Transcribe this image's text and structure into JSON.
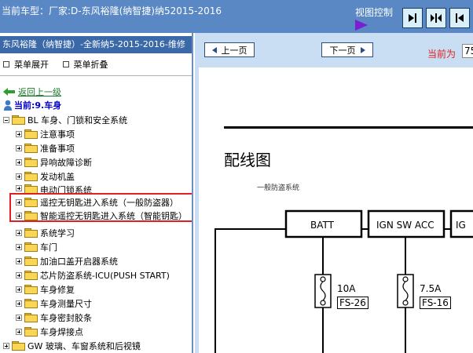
{
  "header": {
    "title": "当前车型：厂家:D-东风裕隆(纳智捷)纳52015-2016",
    "view_control": "视图控制"
  },
  "sidebar": {
    "car_title": "东风裕隆（纳智捷）-全新纳5-2015-2016-维修",
    "expand_menu": "菜单展开",
    "collapse_menu": "菜单折叠",
    "back_link": "返回上一级",
    "current": "当前:9.车身",
    "root_group": "BL 车身、门锁和安全系统",
    "items": [
      "注意事项",
      "准备事项",
      "异响故障诊断",
      "发动机盖",
      "电动门锁系统",
      "遥控无钥匙进入系统（一般防盗器）",
      "智能遥控无钥匙进入系统（智能钥匙）",
      "系统学习",
      "车门",
      "加油口盖开启器系统",
      "芯片防盗系统-ICU(PUSH START)",
      "车身修复",
      "车身测量尺寸",
      "车身密封胶条",
      "车身焊接点"
    ],
    "next_group": "GW 玻璃、车窗系统和后视镜"
  },
  "viewer": {
    "prev_page": "上一页",
    "next_page": "下一页",
    "current_page_label": "当前为",
    "current_page_value": "75"
  },
  "document": {
    "heading": "配线图",
    "subheading": "一般防盗系统",
    "boxes": [
      "BATT",
      "IGN SW ACC",
      "IG"
    ],
    "fuses": [
      {
        "amp": "10A",
        "id": "FS-26"
      },
      {
        "amp": "7.5A",
        "id": "FS-16"
      }
    ]
  },
  "colors": {
    "header_bg": "#5a88c4",
    "sidebar_title_bg": "#3b69a8",
    "viewer_bg": "#c9ddf3",
    "highlight": "#e02020",
    "page_label": "#e02020"
  }
}
